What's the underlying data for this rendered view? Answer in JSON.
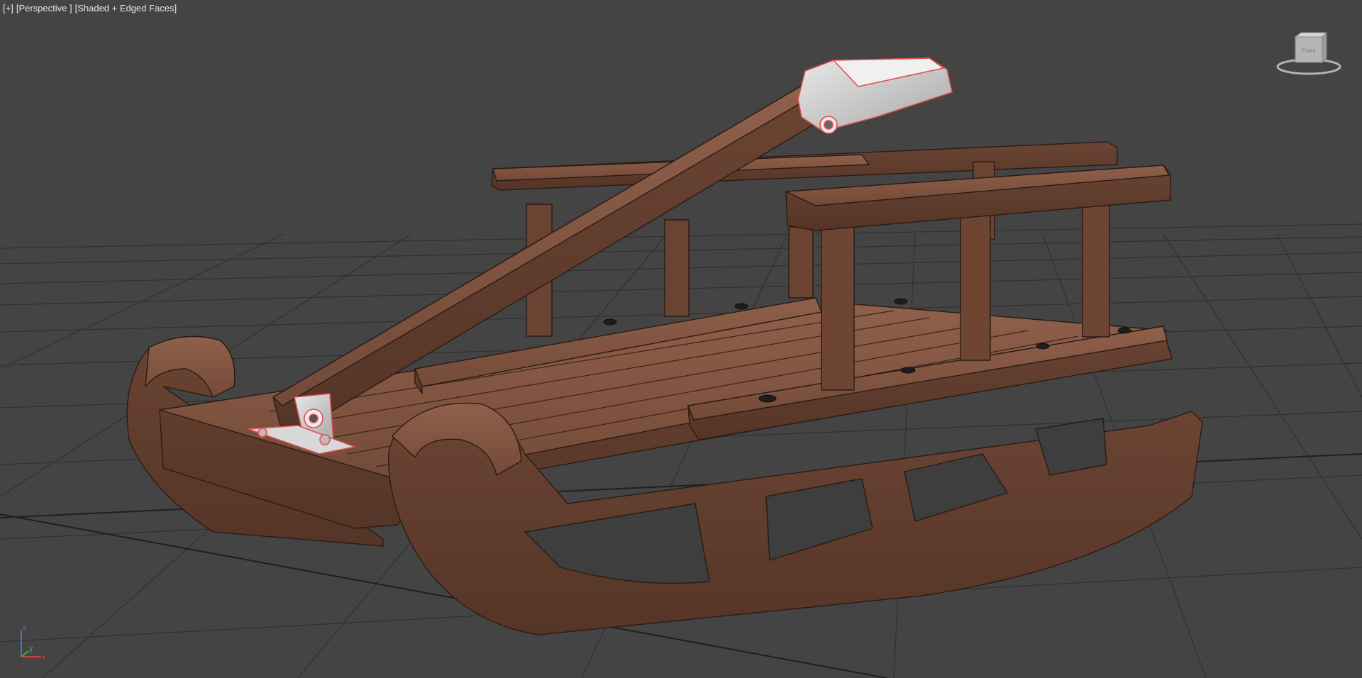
{
  "viewport": {
    "labels": {
      "menu": "[+]",
      "view": "[Perspective ]",
      "shading": "[Shaded + Edged Faces]"
    }
  },
  "viewcube": {
    "face_label": "Front",
    "icon": "viewcube-icon"
  },
  "axes": {
    "z_label": "z",
    "x_label": "x",
    "y_label": "y"
  },
  "colors": {
    "background": "#444444",
    "grid": "#2f2f2f",
    "grid_axis": "#1e1e1e",
    "wood": "#7a4f3e",
    "wood_dark": "#5b3a2d",
    "wood_light": "#8c5e4a",
    "edges": "#2a1b14",
    "metal": "#d2d2d2",
    "selection": "#e05050",
    "axis_x": "#d04040",
    "axis_y": "#40b040",
    "axis_z": "#4a6fd8"
  }
}
